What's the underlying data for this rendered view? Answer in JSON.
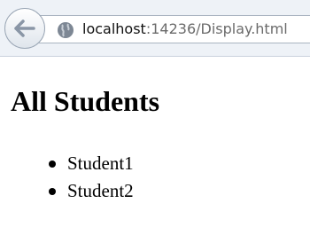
{
  "browser": {
    "url_host": "localhost",
    "url_rest": ":14236/Display.html"
  },
  "page": {
    "title": "All Students",
    "students": [
      "Student1",
      "Student2"
    ]
  }
}
